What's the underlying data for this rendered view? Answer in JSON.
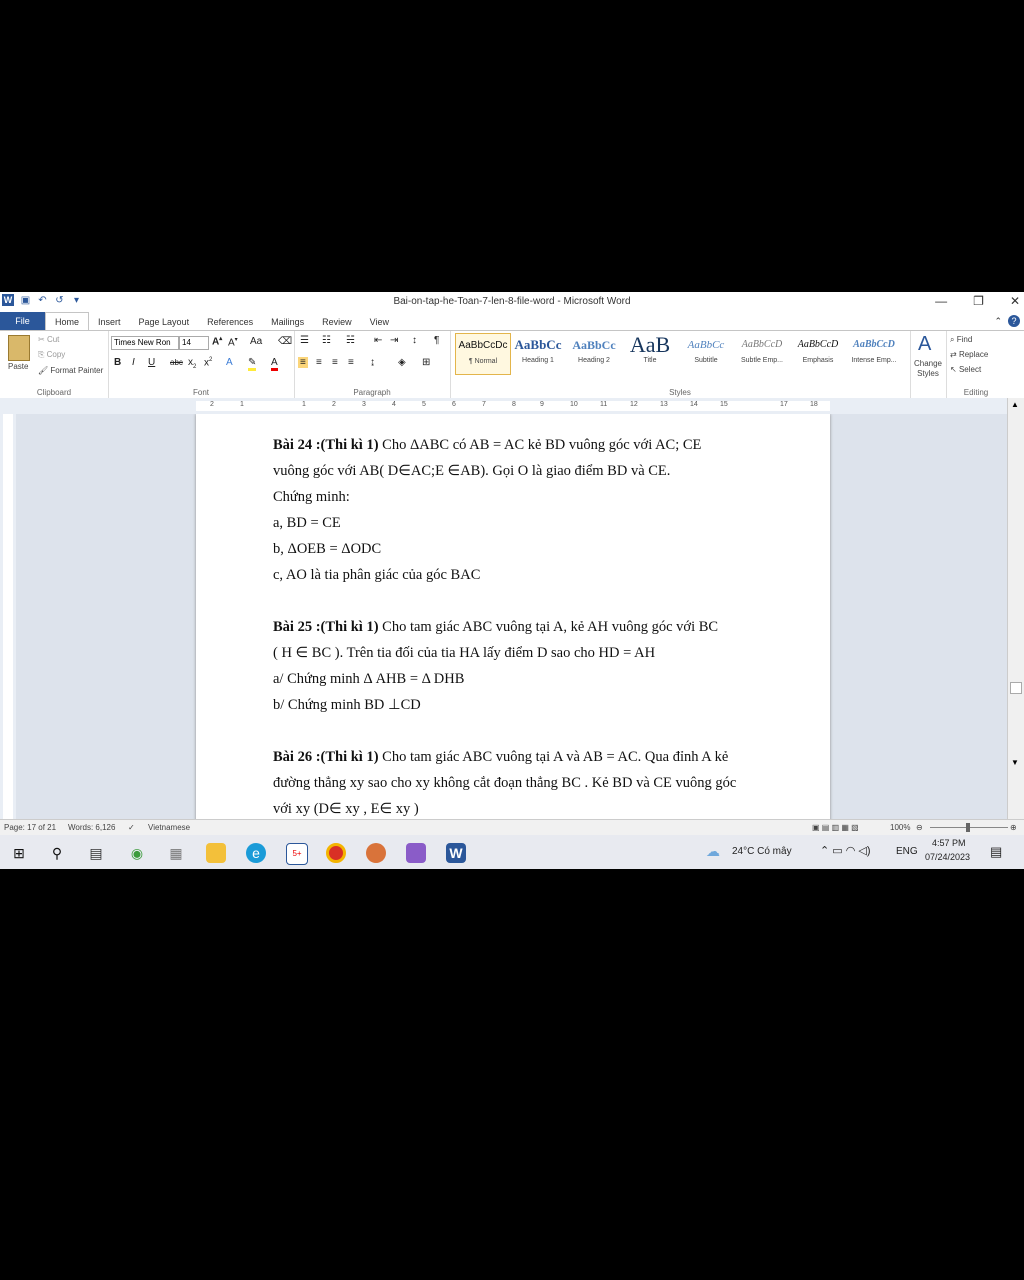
{
  "window": {
    "title": "Bai-on-tap-he-Toan-7-len-8-file-word - Microsoft Word",
    "minimize": "—",
    "restore": "❐",
    "close": "✕"
  },
  "tabs": [
    "File",
    "Home",
    "Insert",
    "Page Layout",
    "References",
    "Mailings",
    "Review",
    "View"
  ],
  "ribbon": {
    "clipboard": {
      "paste": "Paste",
      "cut": "Cut",
      "copy": "Copy",
      "format_painter": "Format Painter",
      "label": "Clipboard"
    },
    "font": {
      "name": "Times New Ron",
      "size": "14",
      "label": "Font"
    },
    "paragraph": {
      "label": "Paragraph"
    },
    "styles": {
      "label": "Styles",
      "items": [
        {
          "sample": "AaBbCcDc",
          "name": "¶ Normal"
        },
        {
          "sample": "AaBbCc",
          "name": "Heading 1"
        },
        {
          "sample": "AaBbCc",
          "name": "Heading 2"
        },
        {
          "sample": "AaB",
          "name": "Title"
        },
        {
          "sample": "AaBbCc",
          "name": "Subtitle"
        },
        {
          "sample": "AaBbCcD",
          "name": "Subtle Emp..."
        },
        {
          "sample": "AaBbCcD",
          "name": "Emphasis"
        },
        {
          "sample": "AaBbCcD",
          "name": "Intense Emp..."
        }
      ],
      "change_styles": "Change Styles"
    },
    "editing": {
      "find": "Find",
      "replace": "Replace",
      "select": "Select",
      "label": "Editing"
    }
  },
  "ruler": [
    "2",
    "1",
    "1",
    "2",
    "3",
    "4",
    "5",
    "6",
    "7",
    "8",
    "9",
    "10",
    "11",
    "12",
    "13",
    "14",
    "15",
    "17",
    "18"
  ],
  "document": {
    "b24_title": "Bài 24 :(Thi kì 1)",
    "b24_l1": " Cho ΔABC  có AB = AC kẻ BD vuông góc với AC; CE",
    "b24_l2": "vuông góc với AB( D∈AC;E ∈AB). Gọi O là giao điểm BD và CE.",
    "b24_l3": "Chứng minh:",
    "b24_l4": "a, BD = CE",
    "b24_l5": "b, ΔOEB = ΔODC",
    "b24_l6": "c, AO là tia phân giác của góc BAC",
    "b25_title": "Bài 25 :(Thi kì 1)",
    "b25_l1": " Cho tam giác ABC vuông tại A, kẻ AH vuông góc với BC",
    "b25_l2": "( H ∈ BC ). Trên tia đối của tia  HA lấy điểm  D sao cho HD = AH",
    "b25_l3": "a/  Chứng minh Δ AHB = Δ DHB",
    "b25_l4": "b/  Chứng minh BD ⊥CD",
    "b26_title": "Bài 26 :(Thi kì 1)",
    "b26_l1": " Cho tam giác ABC vuông tại A và AB = AC. Qua đỉnh A kẻ",
    "b26_l2": "đường thẳng xy sao cho xy không cắt đoạn thẳng BC . Kẻ BD và CE vuông góc",
    "b26_l3": "với xy (D∈ xy , E∈ xy )"
  },
  "status": {
    "page": "Page: 17 of 21",
    "words": "Words: 6,126",
    "language": "Vietnamese",
    "zoom": "100%"
  },
  "taskbar": {
    "weather": "24°C  Có mây",
    "lang": "ENG",
    "time": "4:57 PM",
    "date": "07/24/2023",
    "badge": "5+"
  }
}
